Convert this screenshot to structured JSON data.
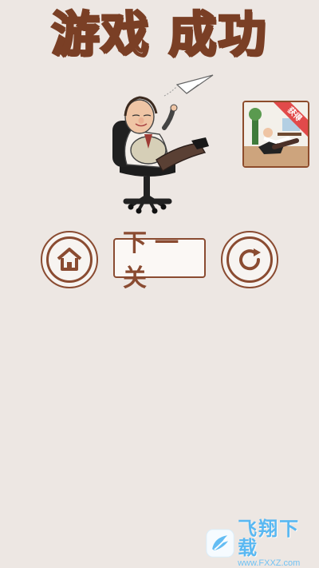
{
  "header": {
    "title": "游戏  成功"
  },
  "reward": {
    "badge_text": "获得"
  },
  "actions": {
    "next_label": "下一关"
  },
  "watermark": {
    "brand": "飞翔下载",
    "url": "www.FXXZ.com"
  },
  "icons": {
    "home": "home-icon",
    "retry": "refresh-icon",
    "logo": "feixiang-logo"
  },
  "colors": {
    "background": "#ede7e3",
    "accent": "#8a4b31",
    "watermark": "#59b8f2",
    "badge": "#e14a4a"
  }
}
